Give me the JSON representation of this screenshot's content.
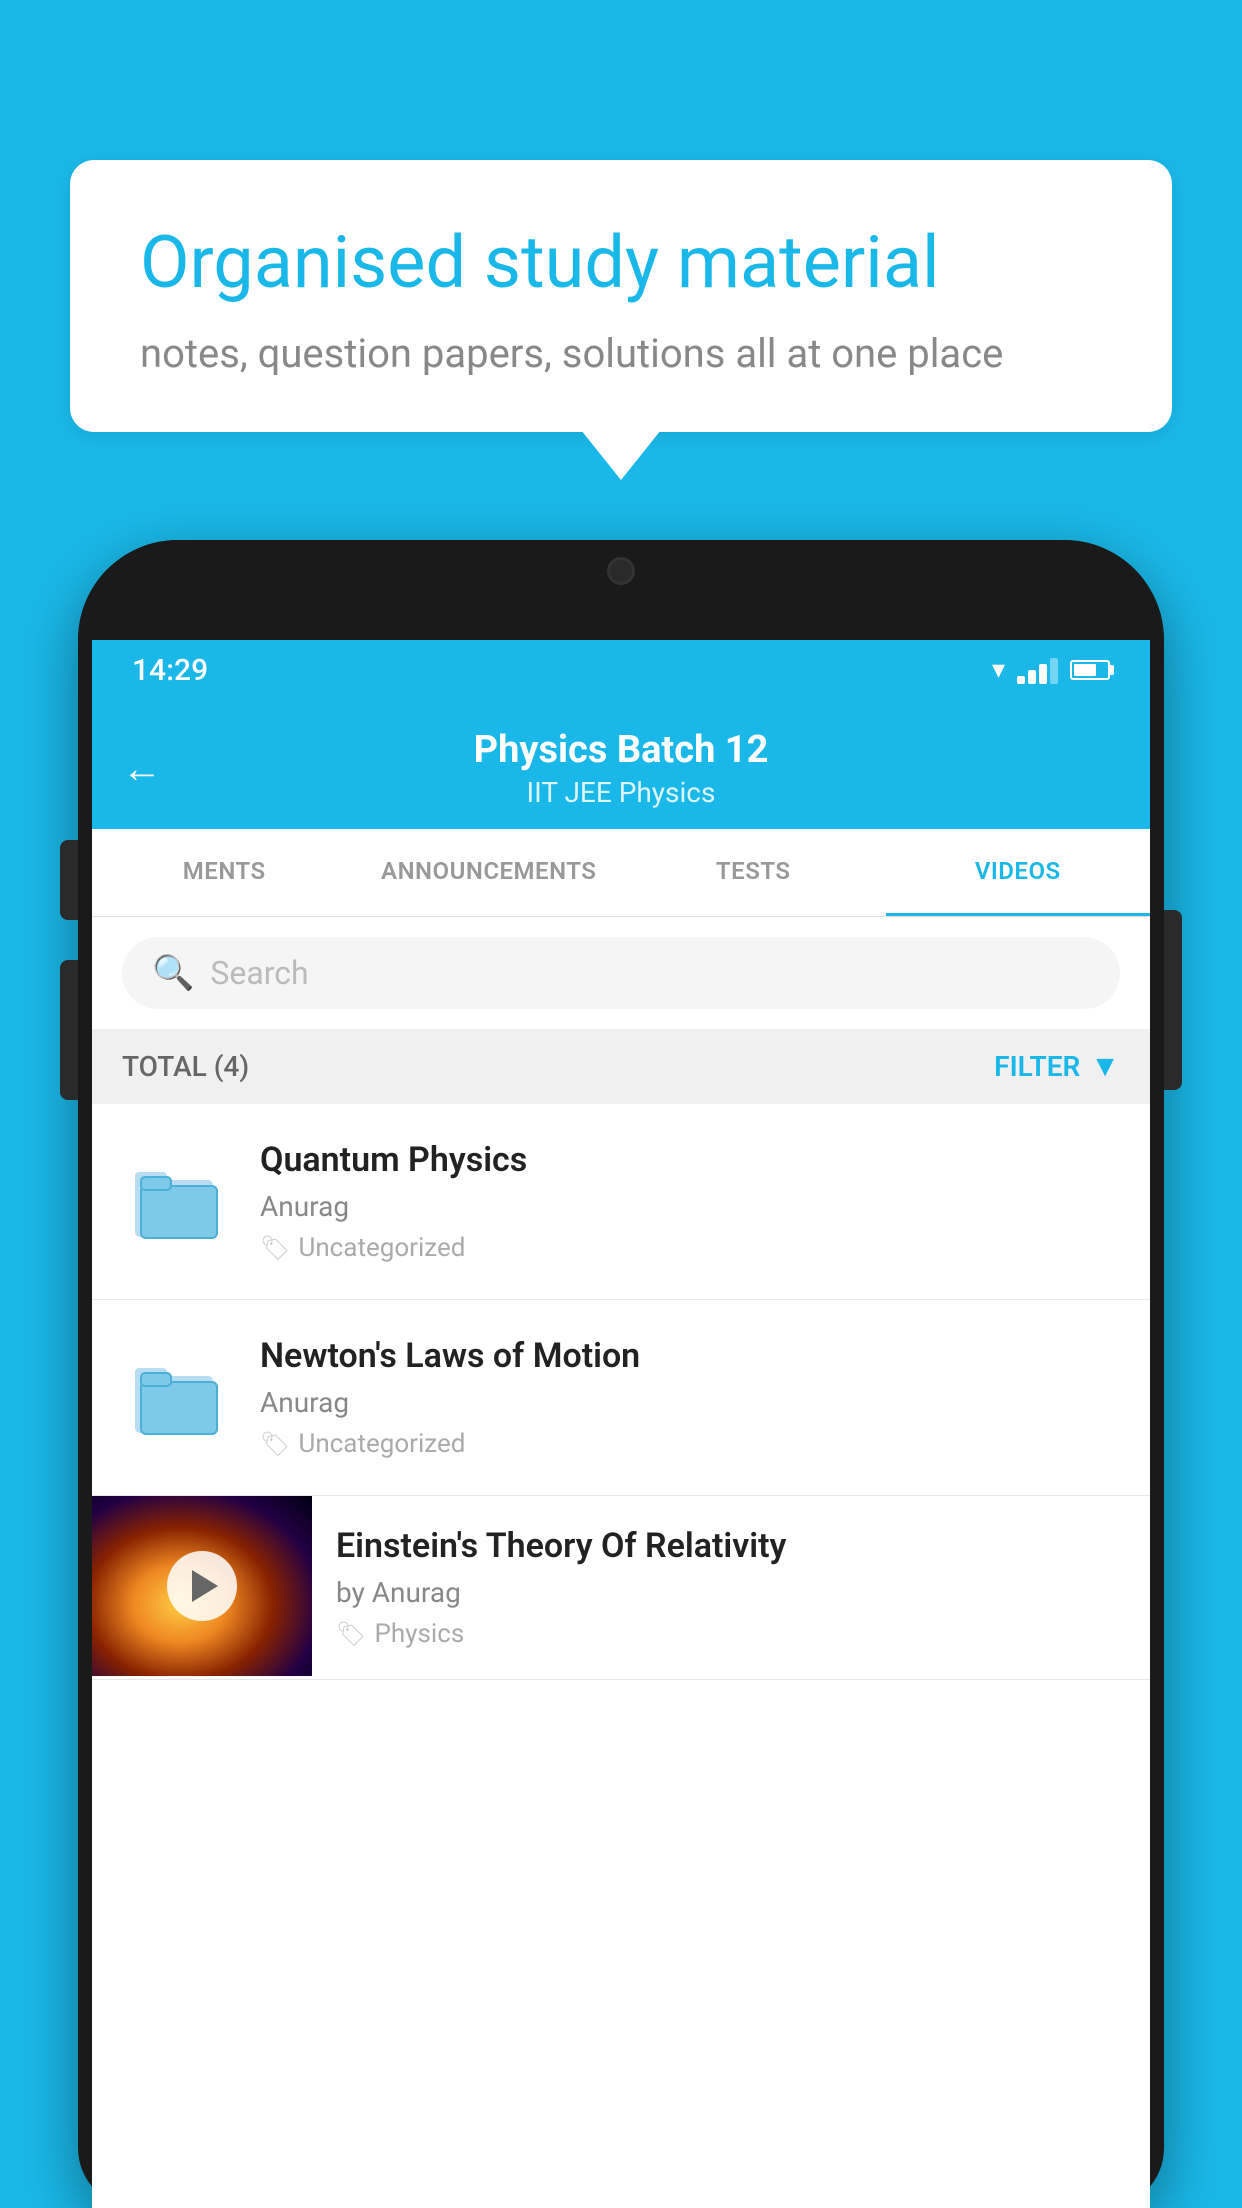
{
  "page": {
    "background_color": "#1ab8e8"
  },
  "speech_bubble": {
    "title": "Organised study material",
    "subtitle": "notes, question papers, solutions all at one place"
  },
  "phone": {
    "status_bar": {
      "time": "14:29"
    },
    "header": {
      "title": "Physics Batch 12",
      "subtitle": "IIT JEE   Physics",
      "back_label": "←"
    },
    "tabs": [
      {
        "label": "MENTS",
        "active": false
      },
      {
        "label": "ANNOUNCEMENTS",
        "active": false
      },
      {
        "label": "TESTS",
        "active": false
      },
      {
        "label": "VIDEOS",
        "active": true
      }
    ],
    "search": {
      "placeholder": "Search"
    },
    "filter_bar": {
      "total_label": "TOTAL (4)",
      "filter_label": "FILTER"
    },
    "videos": [
      {
        "id": "1",
        "title": "Quantum Physics",
        "author": "Anurag",
        "tag": "Uncategorized",
        "type": "folder"
      },
      {
        "id": "2",
        "title": "Newton's Laws of Motion",
        "author": "Anurag",
        "tag": "Uncategorized",
        "type": "folder"
      },
      {
        "id": "3",
        "title": "Einstein's Theory Of Relativity",
        "author": "by Anurag",
        "tag": "Physics",
        "type": "video"
      }
    ]
  }
}
